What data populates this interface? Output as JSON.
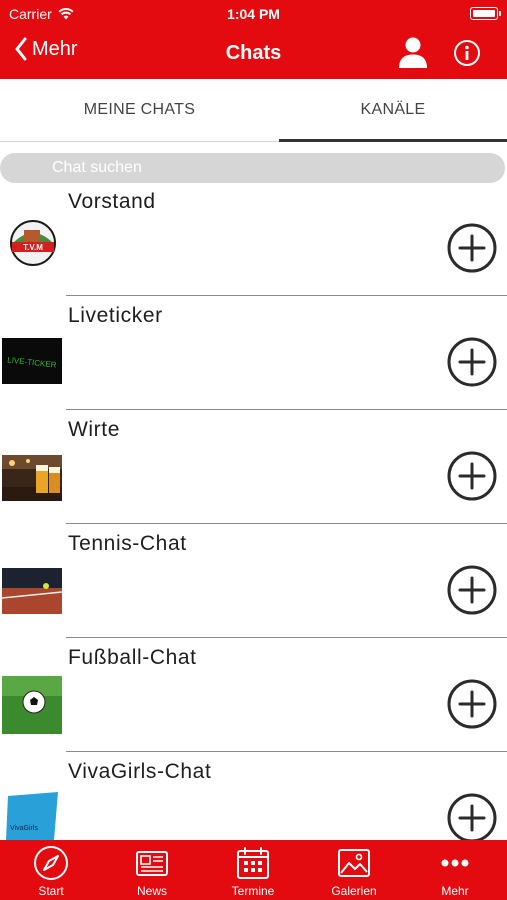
{
  "status_bar": {
    "carrier": "Carrier",
    "time": "1:04 PM"
  },
  "nav": {
    "back_label": "Mehr",
    "title": "Chats"
  },
  "segments": {
    "left": "MEINE CHATS",
    "right": "KANÄLE"
  },
  "search": {
    "placeholder": "Chat suchen"
  },
  "channels": [
    {
      "name": "Vorstand",
      "thumb_text": "T.V.M"
    },
    {
      "name": "Liveticker",
      "thumb_text": "LIVE-TICKER"
    },
    {
      "name": "Wirte"
    },
    {
      "name": "Tennis-Chat"
    },
    {
      "name": "Fußball-Chat"
    },
    {
      "name": "VivaGirls-Chat",
      "thumb_text": "VivaGirls"
    }
  ],
  "tabbar": [
    {
      "label": "Start",
      "icon": "compass-icon"
    },
    {
      "label": "News",
      "icon": "newspaper-icon"
    },
    {
      "label": "Termine",
      "icon": "calendar-icon"
    },
    {
      "label": "Galerien",
      "icon": "image-icon"
    },
    {
      "label": "Mehr",
      "icon": "more-dots-icon"
    }
  ],
  "colors": {
    "brand_red": "#e30b0f"
  }
}
